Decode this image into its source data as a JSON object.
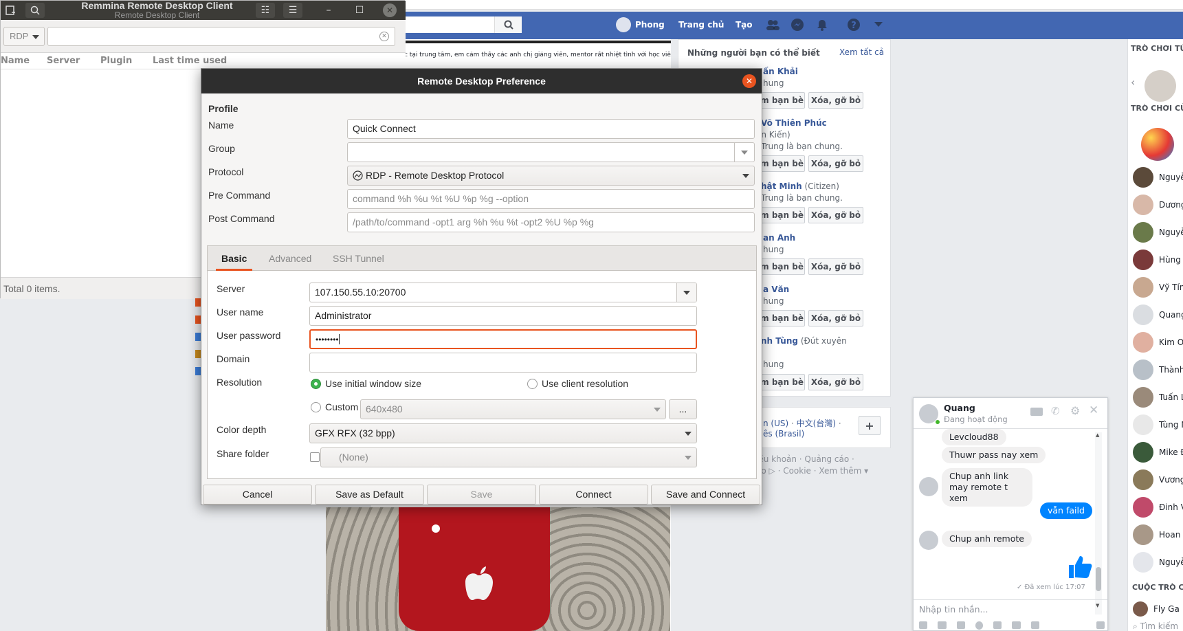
{
  "facebook": {
    "search_icon": "search-icon",
    "nav": {
      "user": "Phong",
      "home": "Trang chủ",
      "create": "Tạo"
    },
    "feed_snippet": "c tại trung tâm, em cảm thấy các anh chị giảng viên, mentor rất nhiệt tình với học viên,",
    "suggest_title": "Những người bạn có thể biết",
    "suggest_all": "Xem tất cả",
    "suggestions": [
      {
        "name": "ấn Khải",
        "sub": "hung"
      },
      {
        "name": "Võ Thiên Phúc",
        "sub": "ơn Kiến)",
        "sub2": "Trung là bạn chung."
      },
      {
        "name": "hật Minh",
        "extra": "(Citizen)",
        "sub": "Trung là bạn chung."
      },
      {
        "name": "an Anh",
        "sub": "hung"
      },
      {
        "name": "a Văn",
        "sub": "hung"
      },
      {
        "name": "nh Tùng",
        "extra": "(Đút xuyên",
        "sub": "hung"
      }
    ],
    "add_friend": "ểm bạn bè",
    "remove": "Xóa, gỡ bỏ",
    "lang": {
      "line1_a": "n (US)",
      "line1_b": "中文(台灣)",
      "line1_sep": "·",
      "line2": "ês (Brasil)",
      "plus": "+"
    },
    "footer": {
      "line1": "iều khoản · Quảng cáo ·",
      "line2_a": "áo ▷",
      "line2_b": "· Cookie · Xem thêm ▾"
    },
    "right_header": "TRÒ CHƠI TỨC",
    "right_header2": "TRÒ CHƠI CỦA",
    "right_contacts": [
      "Nguyễ",
      "Dương",
      "Nguyễ",
      "Hùng N",
      "Vỹ Tín",
      "Quang",
      "Kim Oa",
      "Thành",
      "Tuấn L",
      "Tùng N",
      "Mike Đ",
      "Vương",
      "Đinh V",
      "Hoan L",
      "Nguyễ"
    ],
    "right_footer": "CUỘC TRÒ CH",
    "right_footer2": "Fly Ga",
    "right_search": "Tìm kiếm"
  },
  "chat": {
    "name": "Quang",
    "status": "Đang hoạt động",
    "messages": [
      {
        "text": "Levcloud88",
        "side": "left"
      },
      {
        "text": "Thuwr pass nay xem",
        "side": "left"
      },
      {
        "text": "Chup anh link may remote t xem",
        "side": "left"
      },
      {
        "text": "vẫn faild",
        "side": "right"
      },
      {
        "text": "Chup anh remote",
        "side": "left"
      }
    ],
    "seen": "✓ Đã xem lúc 17:07",
    "placeholder": "Nhập tin nhắn..."
  },
  "remmina": {
    "title": "Remmina Remote Desktop Client",
    "subtitle": "Remote Desktop Client",
    "protocol": "RDP",
    "columns": [
      "Name",
      "Server",
      "Plugin",
      "Last time used"
    ],
    "status": "Total 0 items."
  },
  "dialog": {
    "title": "Remote Desktop Preference",
    "section": "Profile",
    "labels": {
      "name": "Name",
      "group": "Group",
      "protocol": "Protocol",
      "pre": "Pre Command",
      "post": "Post Command"
    },
    "values": {
      "name": "Quick Connect",
      "group": "",
      "protocol": "RDP - Remote Desktop Protocol",
      "pre_placeholder": "command %h %u %t %U %p %g --option",
      "post_placeholder": "/path/to/command -opt1 arg %h %u %t -opt2 %U %p %g"
    },
    "tabs": [
      "Basic",
      "Advanced",
      "SSH Tunnel"
    ],
    "basic": {
      "server_label": "Server",
      "server": "107.150.55.10:20700",
      "user_label": "User name",
      "user": "Administrator",
      "pass_label": "User password",
      "pass": "••••••••",
      "domain_label": "Domain",
      "domain": "",
      "res_label": "Resolution",
      "res_initial": "Use initial window size",
      "res_client": "Use client resolution",
      "res_custom": "Custom",
      "res_custom_value": "640x480",
      "res_more": "...",
      "depth_label": "Color depth",
      "depth": "GFX RFX (32 bpp)",
      "share_label": "Share folder",
      "share": "(None)"
    },
    "buttons": {
      "cancel": "Cancel",
      "default": "Save as Default",
      "save": "Save",
      "connect": "Connect",
      "save_connect": "Save and Connect"
    }
  },
  "colors": {
    "fb_blue": "#4267b2",
    "accent": "#e95420",
    "radio_on": "#3eb34f",
    "messenger_blue": "#0084ff"
  }
}
